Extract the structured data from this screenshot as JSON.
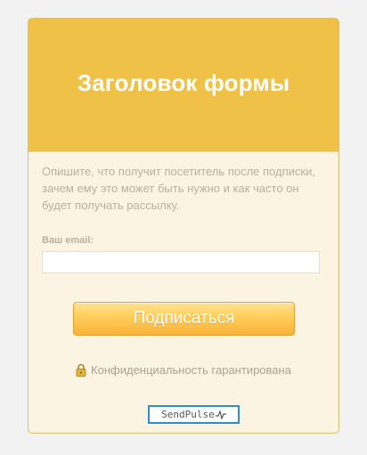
{
  "form": {
    "title": "Заголовок формы",
    "description": "Опишите, что получит посетитель после подписки, зачем ему это может быть нужно и как часто он будет получать рассылку.",
    "email_label": "Ваш email:",
    "email_value": "",
    "email_placeholder": "",
    "submit_label": "Подписаться",
    "privacy_text": "Конфиденциальность гарантирована"
  },
  "branding": {
    "name": "SendPulse"
  },
  "icons": {
    "privacy": "lock-icon",
    "brand": "pulse-icon"
  },
  "colors": {
    "header_bg": "#efc146",
    "card_bg": "#fbf4e2",
    "button_bg": "#ffcd5a",
    "badge_border": "#2e8fc2"
  }
}
